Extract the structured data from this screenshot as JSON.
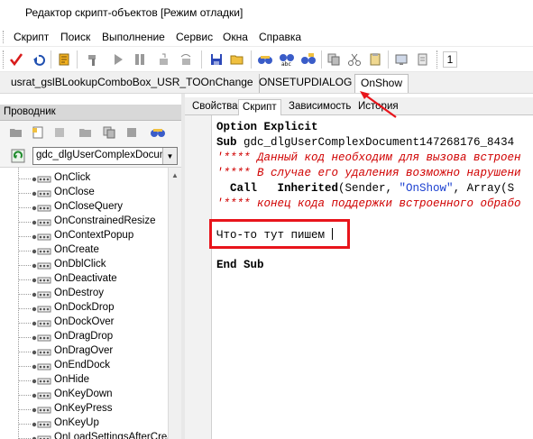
{
  "window": {
    "title": "Редактор скрипт-объектов [Режим отладки]"
  },
  "menu": [
    {
      "label": "Скрипт"
    },
    {
      "label": "Поиск"
    },
    {
      "label": "Выполнение"
    },
    {
      "label": "Сервис"
    },
    {
      "label": "Окна"
    },
    {
      "label": "Справка"
    }
  ],
  "toolbar": {
    "counter": "1"
  },
  "object_tabs": [
    {
      "label": "usrat_gslBLookupComboBox_USR_TOOnChange"
    },
    {
      "label": "ONSETUPDIALOG"
    },
    {
      "label": "OnShow"
    }
  ],
  "explorer": {
    "title": "Проводник",
    "combo_value": "gdc_dlgUserComplexDocume",
    "items": [
      "OnClick",
      "OnClose",
      "OnCloseQuery",
      "OnConstrainedResize",
      "OnContextPopup",
      "OnCreate",
      "OnDblClick",
      "OnDeactivate",
      "OnDestroy",
      "OnDockDrop",
      "OnDockOver",
      "OnDragDrop",
      "OnDragOver",
      "OnEndDock",
      "OnHide",
      "OnKeyDown",
      "OnKeyPress",
      "OnKeyUp",
      "OnLoadSettingsAfterCrea"
    ]
  },
  "editor_tabs": [
    {
      "label": "Свойства"
    },
    {
      "label": "Скрипт"
    },
    {
      "label": "Зависимость"
    },
    {
      "label": "История"
    }
  ],
  "code": {
    "l1": "Option Explicit",
    "l2_kw": "Sub",
    "l2_rest": " gdc_dlgUserComplexDocument147268176_8434",
    "l3": "'**** Данный код необходим для вызова встроен",
    "l4": "'**** В случае его удаления возможно нарушени",
    "l5_a": "  Call   Inherited",
    "l5_b": "(Sender, ",
    "l5_str": "\"OnShow\"",
    "l5_c": ", Array(S",
    "l6": "'**** конец кода поддержки встроенного обрабо",
    "l7": "Что-то тут пишем",
    "l8": "End Sub"
  },
  "colors": {
    "highlight": "#e8141b",
    "comment": "#d00000",
    "string": "#1a3fd0"
  }
}
